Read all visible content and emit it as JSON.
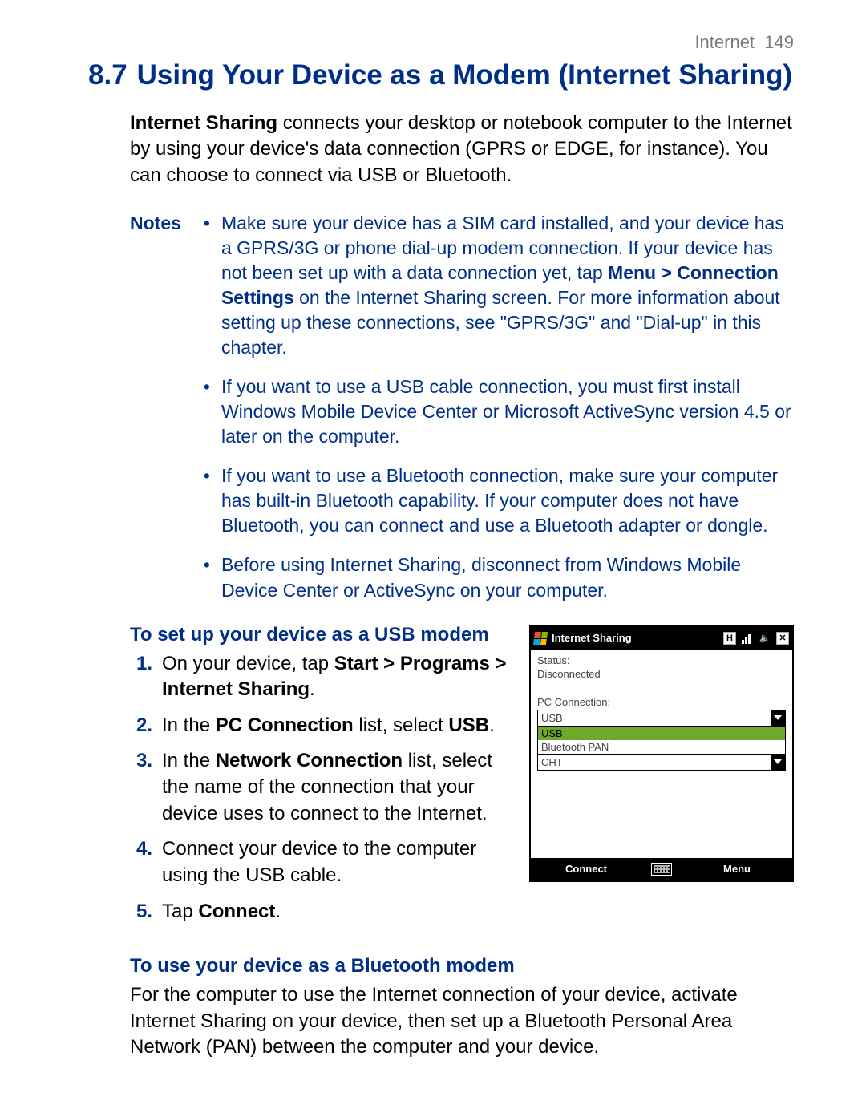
{
  "header": {
    "chapter": "Internet",
    "page_number": "149"
  },
  "section": {
    "number": "8.7",
    "title": "Using Your Device as a Modem (Internet Sharing)"
  },
  "intro": {
    "lead_bold": "Internet Sharing",
    "text": " connects your desktop or notebook computer to the Internet by using your device's data connection (GPRS or EDGE, for instance). You can choose to connect via USB or Bluetooth."
  },
  "notes": {
    "label": "Notes",
    "items": [
      {
        "pre": "Make sure your device has a SIM card installed, and your device has a GPRS/3G or phone dial-up modem connection. If your device has not been set up with a data connection yet, tap ",
        "bold": "Menu > Connection Settings",
        "post": " on the Internet Sharing screen. For more information about setting up these connections, see \"GPRS/3G\" and \"Dial-up\" in this chapter."
      },
      {
        "pre": "If you want to use a USB cable connection, you must first install Windows Mobile Device Center or Microsoft ActiveSync version 4.5 or later on the computer.",
        "bold": "",
        "post": ""
      },
      {
        "pre": "If you want to use a Bluetooth connection, make sure your computer has built-in Bluetooth capability. If your computer does not have Bluetooth, you can connect and use a Bluetooth adapter or dongle.",
        "bold": "",
        "post": ""
      },
      {
        "pre": "Before using Internet Sharing, disconnect from Windows Mobile Device Center or ActiveSync on your computer.",
        "bold": "",
        "post": ""
      }
    ]
  },
  "usb": {
    "heading": "To set up your device as a USB modem",
    "steps": [
      {
        "n": "1.",
        "pre": "On your device, tap ",
        "bold": "Start > Programs > Internet Sharing",
        "post": "."
      },
      {
        "n": "2.",
        "pre": "In the ",
        "bold": "PC Connection",
        "mid": " list, select ",
        "bold2": "USB",
        "post": "."
      },
      {
        "n": "3.",
        "pre": "In the ",
        "bold": "Network Connection",
        "post": " list, select the name of the connection that your device uses to connect to the Internet."
      },
      {
        "n": "4.",
        "pre": "Connect your device to the computer using the USB cable.",
        "bold": "",
        "post": ""
      },
      {
        "n": "5.",
        "pre": "Tap ",
        "bold": "Connect",
        "post": "."
      }
    ]
  },
  "bluetooth": {
    "heading": "To use your device as a Bluetooth modem",
    "para": "For the computer to use the Internet connection of your device, activate Internet Sharing on your device, then set up a Bluetooth Personal Area Network (PAN) between the computer and your device."
  },
  "device": {
    "title": "Internet Sharing",
    "status_label": "Status:",
    "status_value": "Disconnected",
    "pc_label": "PC Connection:",
    "pc_selection": "USB",
    "pc_options": [
      "USB",
      "Bluetooth PAN"
    ],
    "net_selection": "CHT",
    "softkey_left": "Connect",
    "softkey_right": "Menu",
    "title_icons": {
      "h": "H",
      "close": "✕",
      "speaker": "🔈"
    }
  }
}
